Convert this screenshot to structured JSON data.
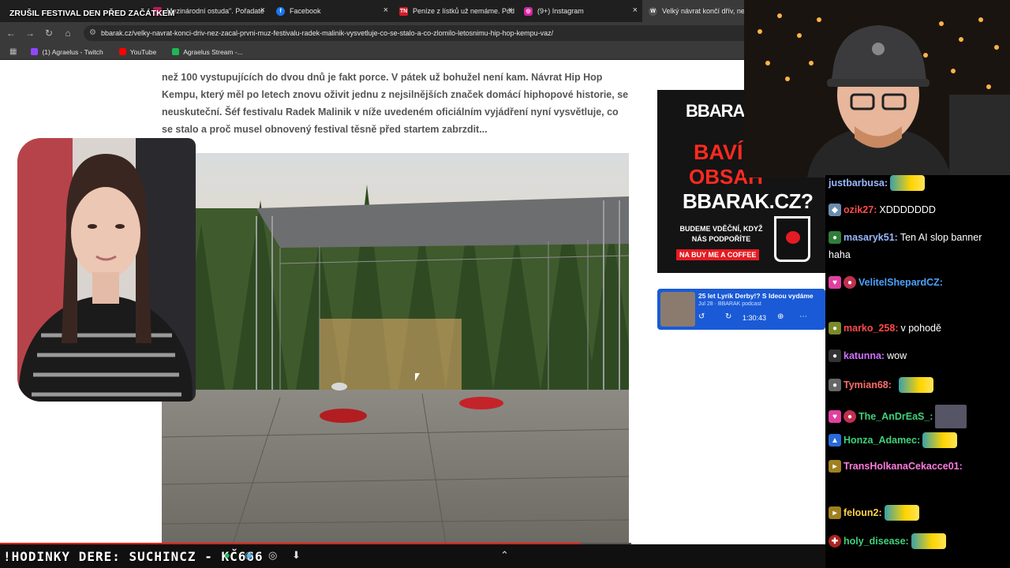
{
  "overlay_title": "ZRUŠIL FESTIVAL DEN PŘED ZAČÁTKEM",
  "tabs": [
    {
      "label": "Mezinárodní ostuda\". Pořadate",
      "icon": "music-icon",
      "color": "#c2185b"
    },
    {
      "label": "Facebook",
      "icon": "facebook-icon",
      "color": "#1877f2"
    },
    {
      "label": "Peníze z lístků už nemáme. Pod",
      "icon": "tn-icon",
      "color": "#d11c2a"
    },
    {
      "label": "(9+) Instagram",
      "icon": "instagram-icon",
      "color": "#d6249f"
    },
    {
      "label": "Velký návrat končí dřív, než za",
      "icon": "wordpress-icon",
      "color": "#555555"
    }
  ],
  "url": "bbarak.cz/velky-navrat-konci-driv-nez-zacal-prvni-muz-festivalu-radek-malinik-vysvetluje-co-se-stalo-a-co-zlomilo-letosnimu-hip-hop-kempu-vaz/",
  "bookmarks": [
    {
      "label": "(1) Agraelus - Twitch",
      "color": "#9146ff"
    },
    {
      "label": "YouTube",
      "color": "#ff0000"
    },
    {
      "label": "Agraelus Stream -...",
      "color": "#1db954"
    }
  ],
  "article": {
    "paragraph": "než 100 vystupujících do dvou dnů je fakt porce. V pátek už bohužel není kam. Návrat Hip Hop Kempu, který měl po letech znovu oživit jednu z nejsilnějších značek domácí hiphopové historie, se neuskuteční. Šéf festivalu Radek Malinik v níže uvedeném oficiálním vyjádření nyní vysvětluje, co se stalo a proč musel obnovený festival těsně před startem zabrzdit..."
  },
  "ad": {
    "brand": "BBARA",
    "line1": "BAVÍ",
    "line2": "OBSAH",
    "line3": "BBARAK.CZ?",
    "line4": "BUDEME VDĚČNÍ, KDYŽ NÁS PODPOŘÍTE",
    "cta": "NA BUY ME A COFFEE"
  },
  "podcast": {
    "title": "25 let Lyrik Derby!? S Ideou vydáme",
    "subtitle": "Jul 28 · BBARAK podcast",
    "time": "1:30:43"
  },
  "chat": [
    {
      "user": "justbarbusa:",
      "color": "#9ab7ff",
      "text": "",
      "emote": true,
      "badge_color": ""
    },
    {
      "user": "ozik27:",
      "color": "#ff4a4a",
      "text": "XDDDDDDD",
      "emote": false,
      "badge_color": "#6b8caf"
    },
    {
      "user": "masaryk51:",
      "color": "#9ab7ff",
      "text": "Ten AI slop banner",
      "emote": false,
      "badge_color": "#2f7d3b"
    },
    {
      "user": "VelitelShepardCZ:",
      "color": "#4aa3ff",
      "text": "",
      "emote": true,
      "badge_color": "#e040a0"
    },
    {
      "user": "marko_258:",
      "color": "#ff4a4a",
      "text": "v pohodě",
      "emote": false,
      "badge_color": "#7a8b2a"
    },
    {
      "user": "katunna:",
      "color": "#d070ff",
      "text": "wow",
      "emote": false,
      "badge_color": "#333333"
    },
    {
      "user": "Tymian68:",
      "color": "#ff6b6b",
      "text": "",
      "emote": true,
      "badge_color": "#666666"
    },
    {
      "user": "The_AnDrEaS_:",
      "color": "#3fd27a",
      "text": "",
      "emote": false,
      "badge_color": "#e040a0"
    },
    {
      "user": "Honza_Adamec:",
      "color": "#3fd27a",
      "text": "",
      "emote": true,
      "badge_color": "#2a6bd8"
    },
    {
      "user": "TransHolkanaCekacce01:",
      "color": "#ff7be0",
      "text": "",
      "emote": true,
      "badge_color": "#a08020"
    },
    {
      "user": "feloun2:",
      "color": "#ffd24a",
      "text": "",
      "emote": true,
      "badge_color": "#a08020"
    },
    {
      "user": "holy_disease:",
      "color": "#3fd27a",
      "text": "",
      "emote": true,
      "badge_color": "#aa2222"
    }
  ],
  "chat_wrap": "haha",
  "ticker": "!HODINKY DERE: SUCHINCZ - KČ666",
  "progress_fraction": 0.92
}
